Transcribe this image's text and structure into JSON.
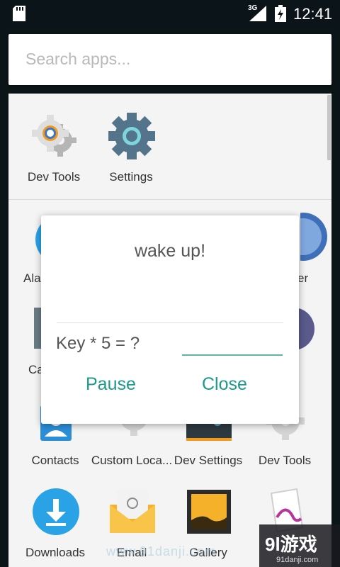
{
  "status_bar": {
    "time": "12:41",
    "network": "3G"
  },
  "search": {
    "placeholder": "Search apps..."
  },
  "predicted_apps": [
    {
      "label": "Dev Tools",
      "icon": "dev-tools-icon"
    },
    {
      "label": "Settings",
      "icon": "settings-icon"
    }
  ],
  "apps": {
    "alarm_partial": "Ala",
    "camera_partial": "Ca",
    "right_partial": "er",
    "contacts": "Contacts",
    "custom_locale": "Custom Loca...",
    "dev_settings": "Dev Settings",
    "dev_tools": "Dev Tools",
    "downloads": "Downloads",
    "email": "Email",
    "gallery": "Gallery"
  },
  "dialog": {
    "title": "wake up!",
    "question": "Key * 5 = ?",
    "answer_value": "",
    "pause_label": "Pause",
    "close_label": "Close"
  },
  "watermark": {
    "text": "www.91danji.com",
    "logo": "9l游戏",
    "domain": "91danji.com"
  },
  "colors": {
    "accent": "#1d9a8a",
    "status_bar": "#0b1418",
    "drawer": "#f4f4f4"
  }
}
